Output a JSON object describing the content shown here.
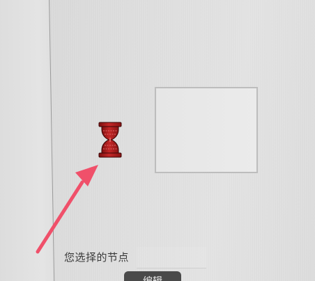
{
  "form": {
    "selected_node_label": "您选择的节点",
    "edit_button_label": "编辑"
  },
  "icons": {
    "busy": "hourglass-icon",
    "annotation": "arrow-icon"
  },
  "colors": {
    "hourglass": "#b01e1e",
    "arrow": "#f0506a",
    "button": "#4a4a4a"
  }
}
